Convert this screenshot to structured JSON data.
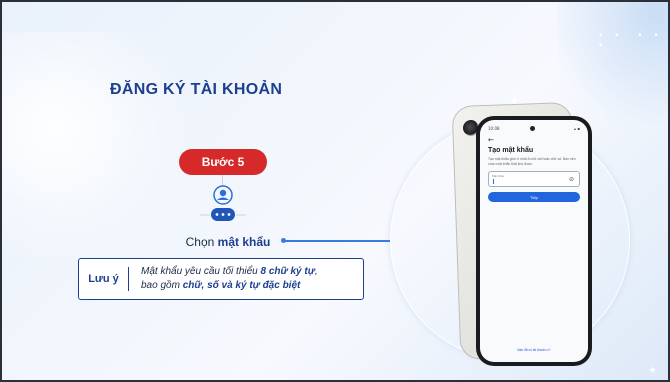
{
  "slide": {
    "title": "ĐĂNG KÝ TÀI KHOẢN",
    "step_label": "Bước 5",
    "action_prefix": "Chọn ",
    "action_highlight": "mật khẩu",
    "note": {
      "label": "Lưu ý",
      "line1_prefix": "Mật khẩu yêu cầu tối thiểu ",
      "line1_strong": "8 chữ ký tự",
      "line1_suffix": ",",
      "line2_prefix": "bao gồm ",
      "line2_strong": "chữ, số và ký tự đặc biệt"
    }
  },
  "phone": {
    "status_time": "10:08",
    "status_right": "▴ ▪",
    "back_icon": "arrow-left-icon",
    "screen_title": "Tạo mật khẩu",
    "screen_description": "Tạo mật khẩu gồm ít nhất 8 chữ cái hoặc chữ số. Bạn nên chọn mật khẩu thật khó đoán.",
    "password_field_label": "Mật khẩu",
    "password_value": "",
    "show_password_icon": "eye-off-icon",
    "next_button": "Tiếp",
    "footer_link": "Bạn đã có tài khoản ư?"
  },
  "colors": {
    "title": "#1d3f8f",
    "badge": "#d62a2a",
    "accent_line": "#3b7ae0",
    "primary_button": "#2266dd"
  }
}
